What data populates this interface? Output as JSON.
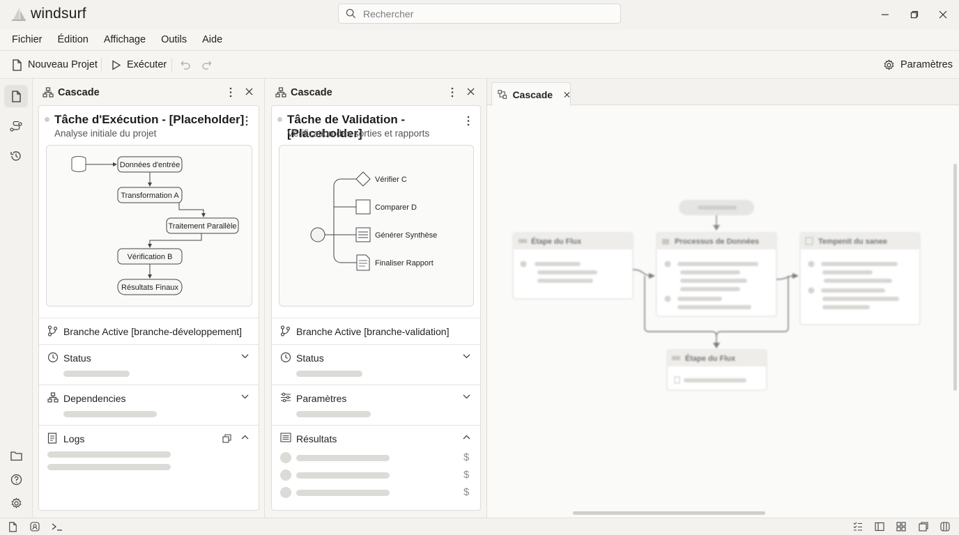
{
  "app": {
    "name": "windsurf"
  },
  "search": {
    "placeholder": "Rechercher"
  },
  "menu": [
    "Fichier",
    "Édition",
    "Affichage",
    "Outils",
    "Aide"
  ],
  "toolbar": {
    "new_project": "Nouveau Projet",
    "run": "Exécuter",
    "settings": "Paramètres"
  },
  "panel1": {
    "header": "Cascade",
    "title": "Tâche d'Exécution - [Placeholder]",
    "subtitle": "Analyse initiale du projet",
    "nodes": [
      "Données d'entrée",
      "Transformation A",
      "Traitement Parallèle",
      "Vérification B",
      "Résultats Finaux"
    ],
    "branch": "Branche Active [branche-développement]",
    "sections": [
      "Status",
      "Dependencies",
      "Logs"
    ]
  },
  "panel2": {
    "header": "Cascade",
    "title": "Tâche de Validation - [Placeholder]",
    "subtitle": "Vérification des sorties et rapports",
    "nodes": [
      "Vérifier C",
      "Comparer D",
      "Générer Synthèse",
      "Finaliser Rapport"
    ],
    "branch": "Branche Active [branche-validation]",
    "sections": [
      "Status",
      "Paramètres",
      "Résultats"
    ],
    "result_symbol": "$"
  },
  "right": {
    "tab": "Cascade",
    "cards": [
      "Étape du Flux",
      "Processus de Données",
      "Tempenit du sanee",
      "Étape du Flux"
    ]
  },
  "colors": {
    "accent": "#222222",
    "skeleton": "#dcdbd8",
    "card_border": "#dedcd8"
  }
}
